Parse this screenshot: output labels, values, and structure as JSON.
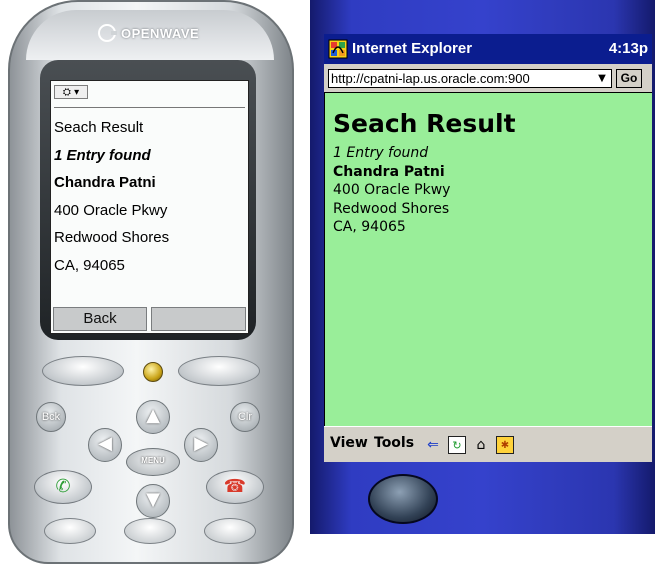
{
  "phone": {
    "brand": "OPENWAVE",
    "selector_icon": "⛭",
    "selector_arrow": "▾",
    "lines": {
      "title": "Seach Result",
      "entries_found": "1 Entry found",
      "name": "Chandra Patni",
      "street": "400 Oracle Pkwy",
      "city": "Redwood Shores",
      "state_zip": "CA, 94065"
    },
    "softkeys": {
      "left": "Back",
      "right": ""
    },
    "keys": {
      "back": "Bck",
      "clear": "Clr",
      "menu": "MENU"
    }
  },
  "pda": {
    "app_title": "Internet Explorer",
    "clock": "4:13p",
    "address": "http://cpatni-lap.us.oracle.com:900",
    "go_label": "Go",
    "content": {
      "heading": "Seach Result",
      "entries_found": "1 Entry found",
      "name": "Chandra Patni",
      "street": "400 Oracle Pkwy",
      "city": "Redwood Shores",
      "state_zip": "CA, 94065"
    },
    "menu": {
      "view": "View",
      "tools": "Tools"
    },
    "colors": {
      "content_bg": "#99ee99",
      "titlebar_bg": "#0b1d8f",
      "bezel": "#3542cc"
    },
    "toolbar_icons": [
      "back-arrow-icon",
      "refresh-icon",
      "home-icon",
      "favorites-icon"
    ]
  }
}
